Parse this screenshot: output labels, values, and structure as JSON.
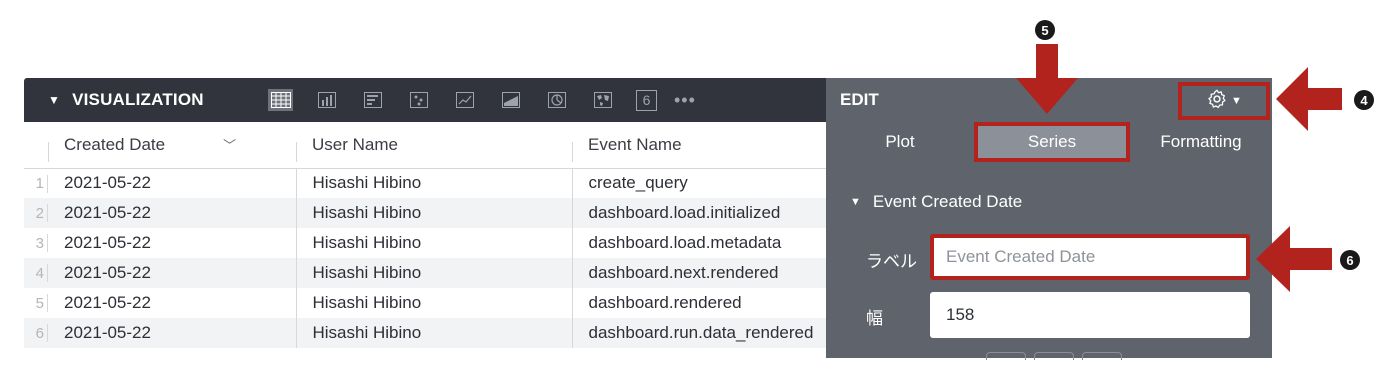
{
  "toolbar": {
    "title": "VISUALIZATION",
    "viz_icons": [
      "table-icon",
      "column-chart-icon",
      "bar-chart-icon",
      "scatter-icon",
      "line-chart-icon",
      "area-chart-icon",
      "pie-chart-icon",
      "map-icon",
      "single-value-icon"
    ],
    "single_value_label": "6",
    "more_label": "•••"
  },
  "table": {
    "headers": [
      "Created Date",
      "User Name",
      "Event Name"
    ],
    "rows": [
      {
        "num": "1",
        "date": "2021-05-22",
        "user": "Hisashi Hibino",
        "event": "create_query"
      },
      {
        "num": "2",
        "date": "2021-05-22",
        "user": "Hisashi Hibino",
        "event": "dashboard.load.initialized"
      },
      {
        "num": "3",
        "date": "2021-05-22",
        "user": "Hisashi Hibino",
        "event": "dashboard.load.metadata"
      },
      {
        "num": "4",
        "date": "2021-05-22",
        "user": "Hisashi Hibino",
        "event": "dashboard.next.rendered"
      },
      {
        "num": "5",
        "date": "2021-05-22",
        "user": "Hisashi Hibino",
        "event": "dashboard.rendered"
      },
      {
        "num": "6",
        "date": "2021-05-22",
        "user": "Hisashi Hibino",
        "event": "dashboard.run.data_rendered"
      }
    ]
  },
  "edit": {
    "title": "EDIT",
    "tabs": {
      "plot": "Plot",
      "series": "Series",
      "formatting": "Formatting"
    },
    "section_title": "Event Created Date",
    "label_field": {
      "label": "ラベル",
      "placeholder": "Event Created Date"
    },
    "width_field": {
      "label": "幅",
      "value": "158"
    }
  },
  "annotations": {
    "gear": "4",
    "series": "5",
    "label": "6"
  },
  "colors": {
    "toolbar_bg": "#31343c",
    "panel_bg": "#5e636c",
    "highlight": "#b3231d",
    "active_tab": "#8c9199"
  }
}
